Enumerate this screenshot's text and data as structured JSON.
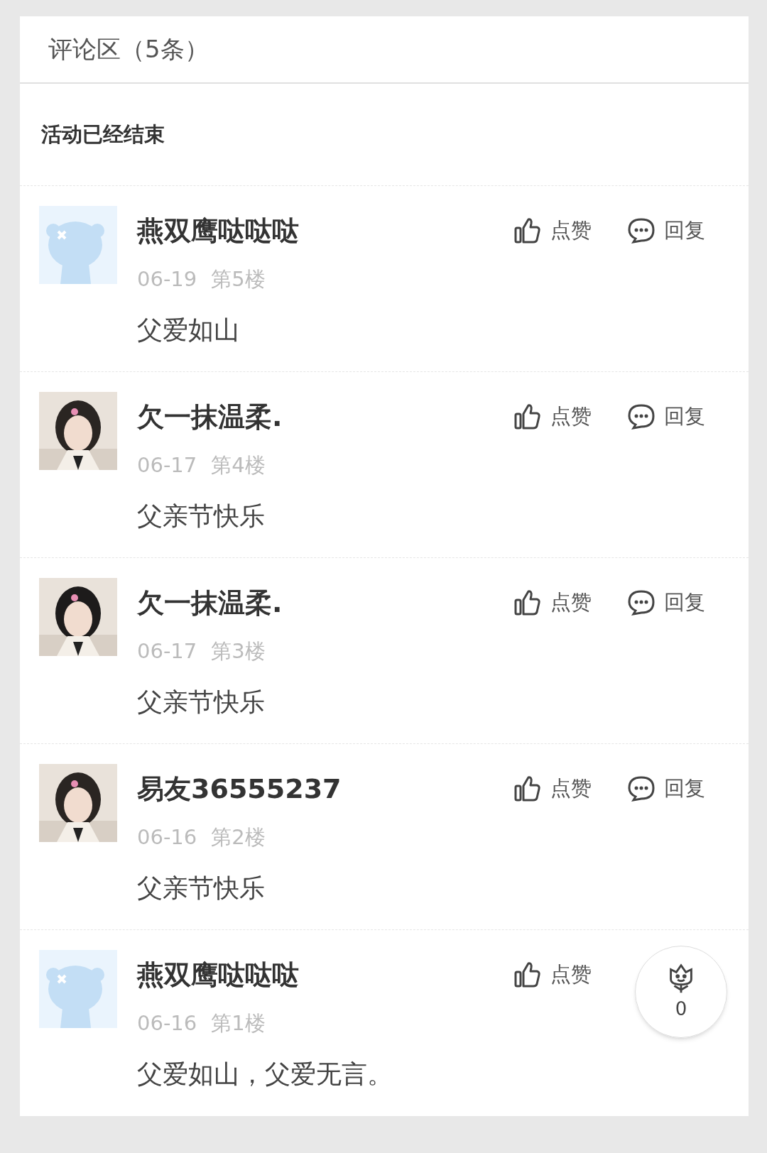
{
  "header": {
    "title": "评论区（5条）"
  },
  "notice": "活动已经结束",
  "comments": [
    {
      "avatar": {
        "kind": "default"
      },
      "name": "燕双鹰哒哒哒",
      "date": "06-19",
      "floor": "第5楼",
      "text": "父爱如山",
      "like_label": "点赞",
      "reply_label": "回复"
    },
    {
      "name": "欠一抹温柔.",
      "date": "06-17",
      "floor": "第4楼",
      "text": "父亲节快乐",
      "like_label": "点赞",
      "reply_label": "回复"
    },
    {
      "name": "欠一抹温柔.",
      "date": "06-17",
      "floor": "第3楼",
      "text": "父亲节快乐",
      "like_label": "点赞",
      "reply_label": "回复"
    },
    {
      "name": "易友36555237",
      "date": "06-16",
      "floor": "第2楼",
      "text": "父亲节快乐",
      "like_label": "点赞",
      "reply_label": "回复"
    },
    {
      "avatar": {
        "kind": "default"
      },
      "name": "燕双鹰哒哒哒",
      "date": "06-16",
      "floor": "第1楼",
      "text": "父爱如山，父爱无言。",
      "like_label": "点赞"
    }
  ],
  "float_button": {
    "count": "0"
  }
}
